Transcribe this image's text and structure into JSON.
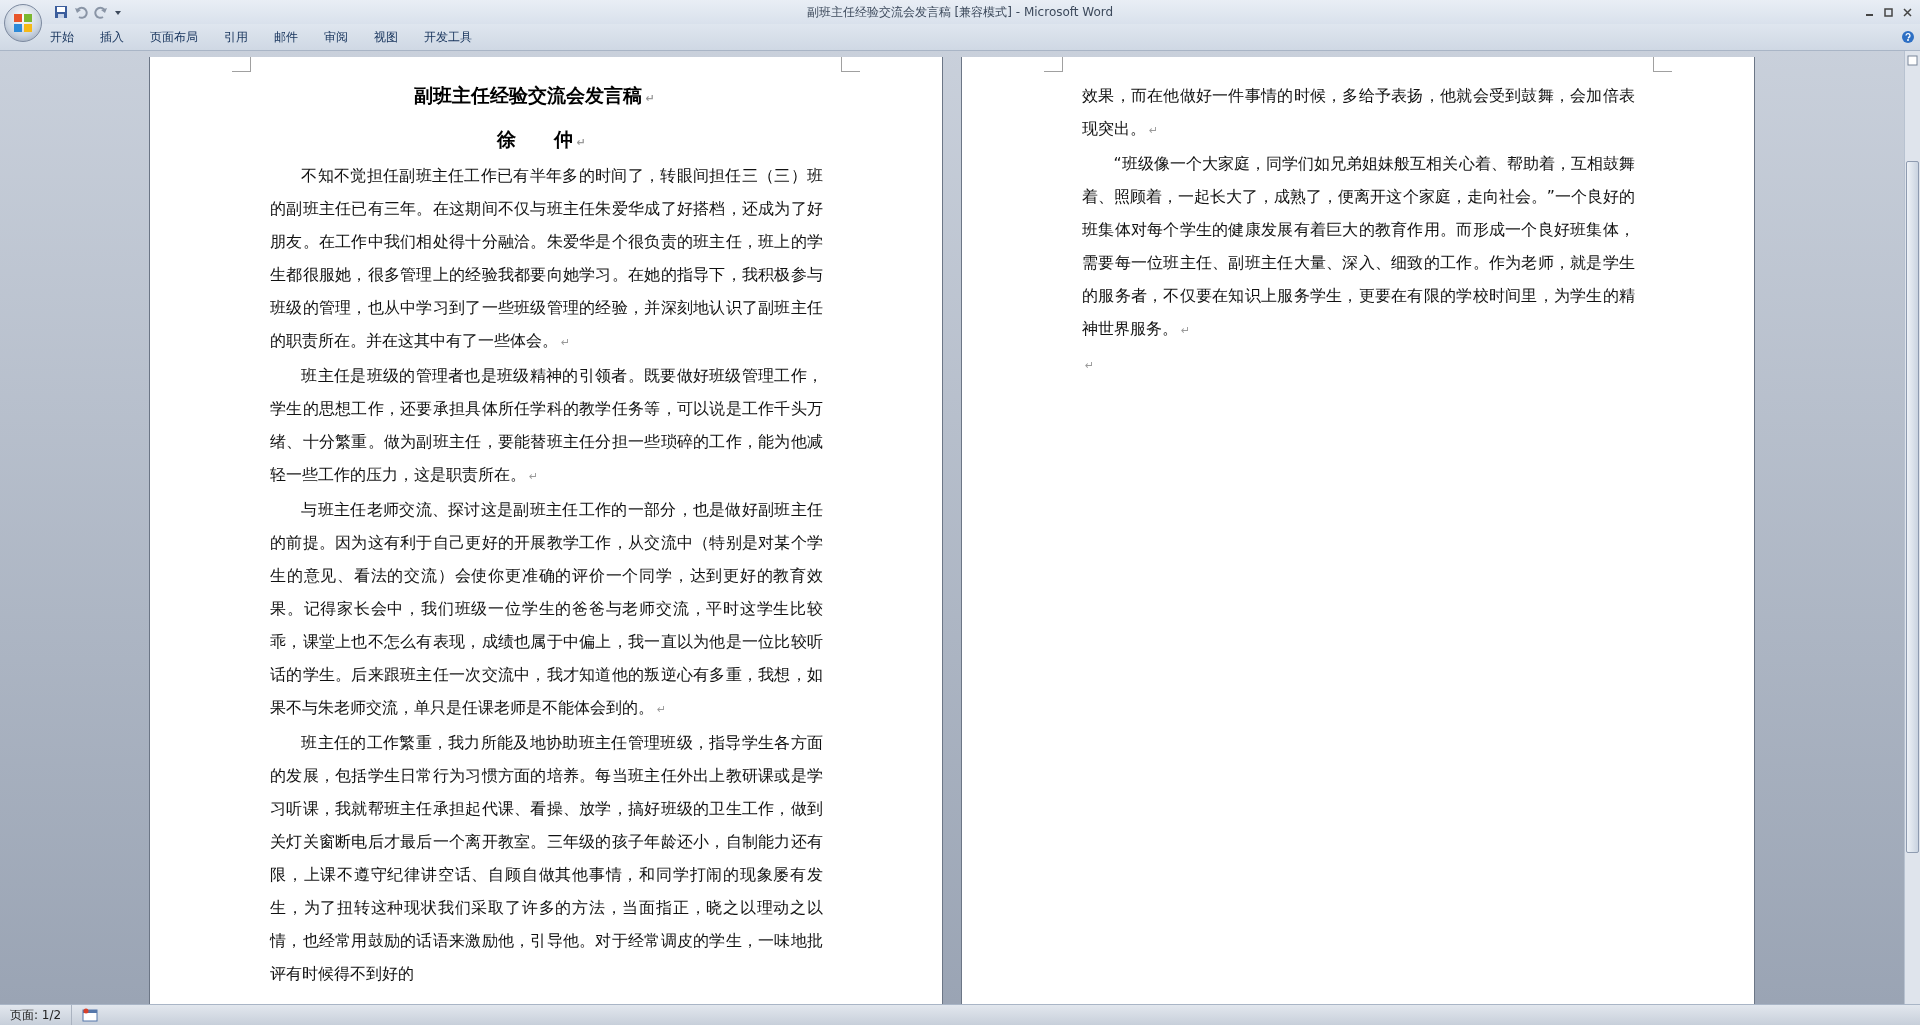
{
  "window": {
    "title": "副班主任经验交流会发言稿 [兼容模式] - Microsoft Word"
  },
  "ribbon_tabs": [
    {
      "label": "开始"
    },
    {
      "label": "插入"
    },
    {
      "label": "页面布局"
    },
    {
      "label": "引用"
    },
    {
      "label": "邮件"
    },
    {
      "label": "审阅"
    },
    {
      "label": "视图"
    },
    {
      "label": "开发工具"
    }
  ],
  "pages": [
    {
      "title": {
        "text": "副班主任经验交流会发言稿",
        "end_mark": "↵"
      },
      "author": {
        "text": "徐　　仲",
        "end_mark": "↵"
      },
      "paragraphs": [
        {
          "indent": true,
          "text": "不知不觉担任副班主任工作已有半年多的时间了，转眼间担任三（三）班的副班主任已有三年。在这期间不仅与班主任朱爱华成了好搭档，还成为了好朋友。在工作中我们相处得十分融洽。朱爱华是个很负责的班主任，班上的学生都很服她，很多管理上的经验我都要向她学习。在她的指导下，我积极参与班级的管理，也从中学习到了一些班级管理的经验，并深刻地认识了副班主任的职责所在。并在这其中有了一些体会。",
          "end_mark": "↵"
        },
        {
          "indent": true,
          "text": "班主任是班级的管理者也是班级精神的引领者。既要做好班级管理工作，学生的思想工作，还要承担具体所任学科的教学任务等，可以说是工作千头万绪、十分繁重。做为副班主任，要能替班主任分担一些琐碎的工作，能为他减轻一些工作的压力，这是职责所在。",
          "end_mark": "↵"
        },
        {
          "indent": true,
          "text": "与班主任老师交流、探讨这是副班主任工作的一部分，也是做好副班主任的前提。因为这有利于自己更好的开展教学工作，从交流中（特别是对某个学生的意见、看法的交流）会使你更准确的评价一个同学，达到更好的教育效果。记得家长会中，我们班级一位学生的爸爸与老师交流，平时这学生比较乖，课堂上也不怎么有表现，成绩也属于中偏上，我一直以为他是一位比较听话的学生。后来跟班主任一次交流中，我才知道他的叛逆心有多重，我想，如果不与朱老师交流，单只是任课老师是不能体会到的。",
          "end_mark": "↵"
        },
        {
          "indent": true,
          "text": "班主任的工作繁重，我力所能及地协助班主任管理班级，指导学生各方面的发展，包括学生日常行为习惯方面的培养。每当班主任外出上教研课或是学习听课，我就帮班主任承担起代课、看操、放学，搞好班级的卫生工作，做到关灯关窗断电后才最后一个离开教室。三年级的孩子年龄还小，自制能力还有限，上课不遵守纪律讲空话、自顾自做其他事情，和同学打闹的现象屡有发生，为了扭转这种现状我们采取了许多的方法，当面指正，晓之以理动之以情，也经常用鼓励的话语来激励他，引导他。对于经常调皮的学生，一味地批评有时候得不到好的"
        }
      ]
    },
    {
      "paragraphs": [
        {
          "indent": false,
          "text": "效果，而在他做好一件事情的时候，多给予表扬，他就会受到鼓舞，会加倍表现突出。",
          "end_mark": "↵"
        },
        {
          "indent": true,
          "text": "“班级像一个大家庭，同学们如兄弟姐妹般互相关心着、帮助着，互相鼓舞着、照顾着，一起长大了，成熟了，便离开这个家庭，走向社会。”一个良好的班集体对每个学生的健康发展有着巨大的教育作用。而形成一个良好班集体，需要每一位班主任、副班主任大量、深入、细致的工作。作为老师，就是学生的服务者，不仅要在知识上服务学生，更要在有限的学校时间里，为学生的精神世界服务。",
          "end_mark": "↵"
        },
        {
          "indent": false,
          "end_mark": "↵"
        }
      ]
    }
  ],
  "status_bar": {
    "page": "页面: 1/2"
  }
}
